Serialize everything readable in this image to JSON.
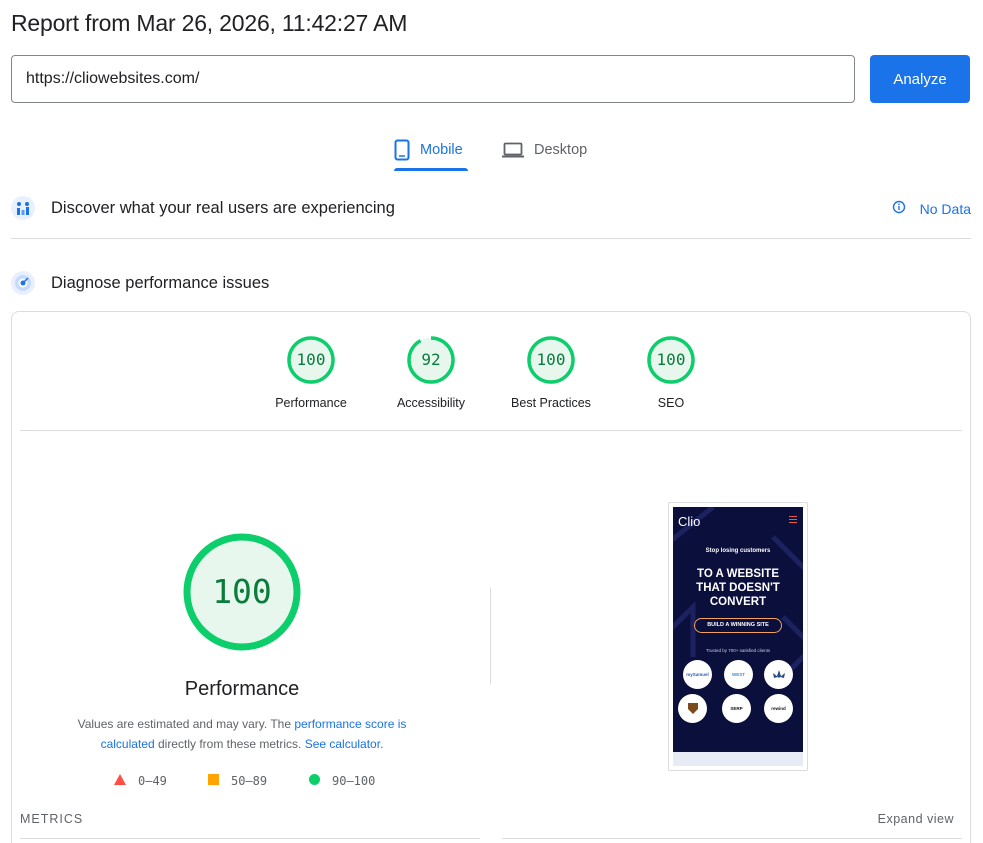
{
  "report": {
    "title": "Report from Mar 26, 2026, 11:42:27 AM"
  },
  "search": {
    "url_value": "https://cliowebsites.com/",
    "analyze_label": "Analyze"
  },
  "tabs": {
    "mobile": "Mobile",
    "desktop": "Desktop",
    "active": "mobile"
  },
  "crux": {
    "title": "Discover what your real users are experiencing",
    "status": "No Data"
  },
  "diagnose": {
    "title": "Diagnose performance issues"
  },
  "scores": [
    {
      "label": "Performance",
      "value": 100,
      "fraction": 1.0
    },
    {
      "label": "Accessibility",
      "value": 92,
      "fraction": 0.92
    },
    {
      "label": "Best Practices",
      "value": 100,
      "fraction": 1.0
    },
    {
      "label": "SEO",
      "value": 100,
      "fraction": 1.0
    }
  ],
  "performance": {
    "score": 100,
    "title": "Performance",
    "desc_prefix": "Values are estimated and may vary. The ",
    "desc_link1": "performance score is calculated",
    "desc_middle": " directly from these metrics. ",
    "desc_link2": "See calculator."
  },
  "legend": {
    "fail": "0–49",
    "average": "50–89",
    "pass": "90–100"
  },
  "colors": {
    "accent": "#1a73e8",
    "pass": "#0cce6b",
    "average": "#ffa400",
    "fail": "#ff4e42",
    "pass_text": "#0a7c3c"
  },
  "screenshot": {
    "logo": "Clio",
    "pretitle": "Stop losing customers",
    "headline_1": "TO A WEBSITE",
    "headline_2": "THAT DOESN'T",
    "headline_3": "CONVERT",
    "cta": "BUILD A WINNING SITE",
    "trusted": "Trusted by 700+ satisfied clients",
    "client_logos": [
      "mySamuel",
      "WEST",
      "",
      "",
      "SERP",
      "rewind"
    ]
  },
  "metrics": {
    "label": "METRICS",
    "expand": "Expand view"
  }
}
